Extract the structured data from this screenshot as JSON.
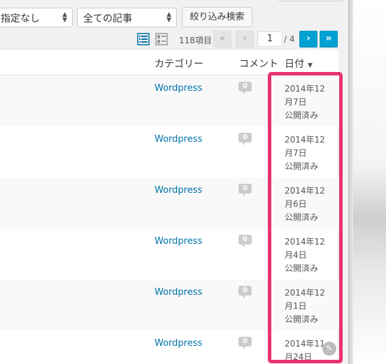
{
  "filters": {
    "author_select": "指定なし",
    "category_select": "全ての記事",
    "filter_button": "絞り込み検索"
  },
  "pagination": {
    "items_count": "118項目",
    "first": "«",
    "prev": "‹",
    "current_page": "1",
    "total": "/ 4",
    "next": "›",
    "last": "»"
  },
  "table": {
    "headers": {
      "category": "カテゴリー",
      "comments": "コメント",
      "date": "日付",
      "sort_indicator": "▼"
    },
    "rows": [
      {
        "category": "Wordpress",
        "comments": "0",
        "date_line1": "2014年12",
        "date_line2": "月7日",
        "status": "公開済み"
      },
      {
        "category": "Wordpress",
        "comments": "0",
        "date_line1": "2014年12",
        "date_line2": "月7日",
        "status": "公開済み"
      },
      {
        "category": "Wordpress",
        "comments": "0",
        "date_line1": "2014年12",
        "date_line2": "月6日",
        "status": "公開済み"
      },
      {
        "category": "Wordpress",
        "comments": "0",
        "date_line1": "2014年12",
        "date_line2": "月4日",
        "status": "公開済み"
      },
      {
        "category": "Wordpress",
        "comments": "0",
        "date_line1": "2014年12",
        "date_line2": "月1日",
        "status": "公開済み"
      },
      {
        "category": "Wordpress",
        "comments": "0",
        "date_line1": "2014年11",
        "date_line2": "月24日",
        "status": ""
      }
    ]
  },
  "colors": {
    "highlight": "#e8336e",
    "link": "#0073aa",
    "active_page": "#00a0d2"
  },
  "icons": {
    "list_view": "list-view-icon",
    "excerpt_view": "excerpt-view-icon",
    "comment_bubble": "comment-bubble-icon",
    "corner": "edit-icon"
  }
}
